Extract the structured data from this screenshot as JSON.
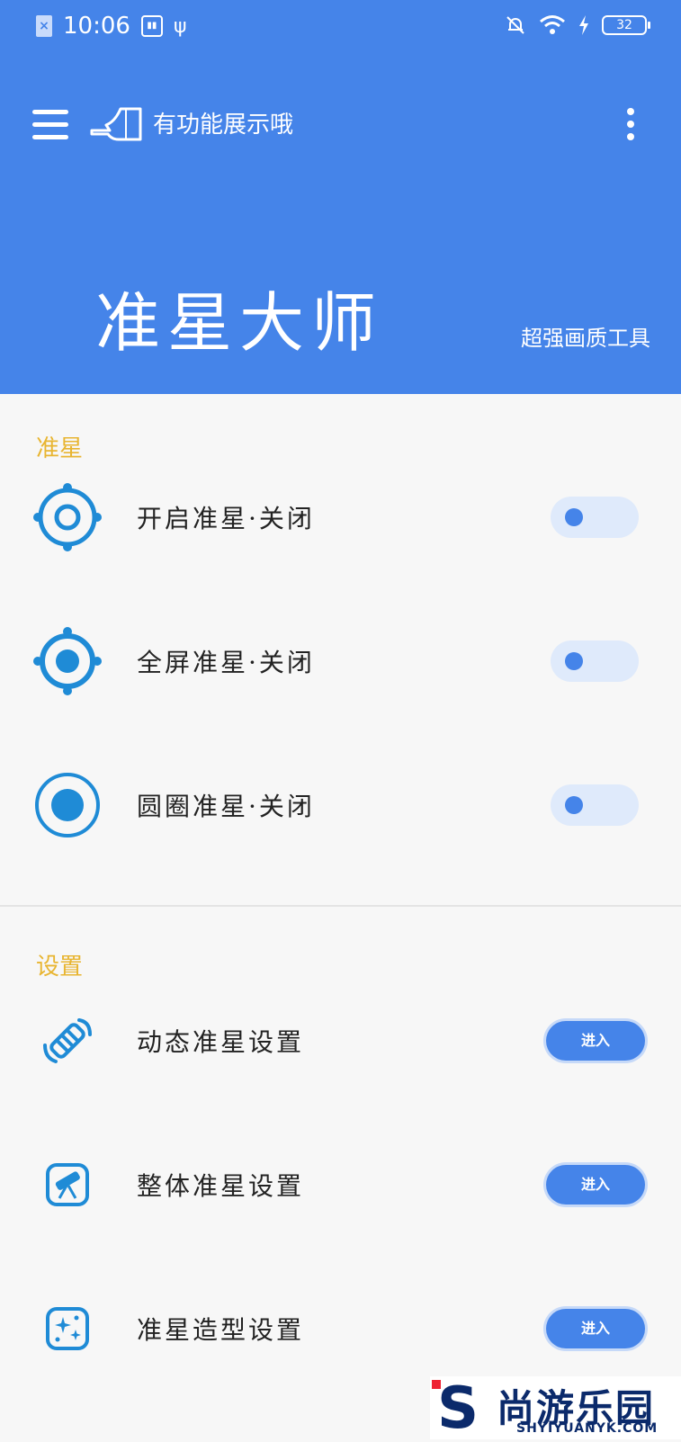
{
  "status_bar": {
    "time": "10:06",
    "battery": "32"
  },
  "header": {
    "hint": "有功能展示哦",
    "title": "准星大师",
    "subtitle": "超强画质工具"
  },
  "sections": [
    {
      "title": "准星",
      "items": [
        {
          "label": "开启准星·关闭",
          "icon": "crosshair-ring-icon",
          "control": "toggle",
          "on": false
        },
        {
          "label": "全屏准星·关闭",
          "icon": "crosshair-dot-icon",
          "control": "toggle",
          "on": false
        },
        {
          "label": "圆圈准星·关闭",
          "icon": "circle-target-icon",
          "control": "toggle",
          "on": false
        }
      ]
    },
    {
      "title": "设置",
      "items": [
        {
          "label": "动态准星设置",
          "icon": "satellite-icon",
          "control": "button",
          "button_label": "进入"
        },
        {
          "label": "整体准星设置",
          "icon": "telescope-icon",
          "control": "button",
          "button_label": "进入"
        },
        {
          "label": "准星造型设置",
          "icon": "sparkle-icon",
          "control": "button",
          "button_label": "进入"
        }
      ]
    }
  ],
  "watermark": {
    "letter": "S",
    "name": "尚游乐园",
    "domain": "SHYIYUANYK.COM"
  },
  "colors": {
    "accent": "#4584e9",
    "section_title": "#e8b531",
    "toggle_track": "#dfeafb"
  }
}
